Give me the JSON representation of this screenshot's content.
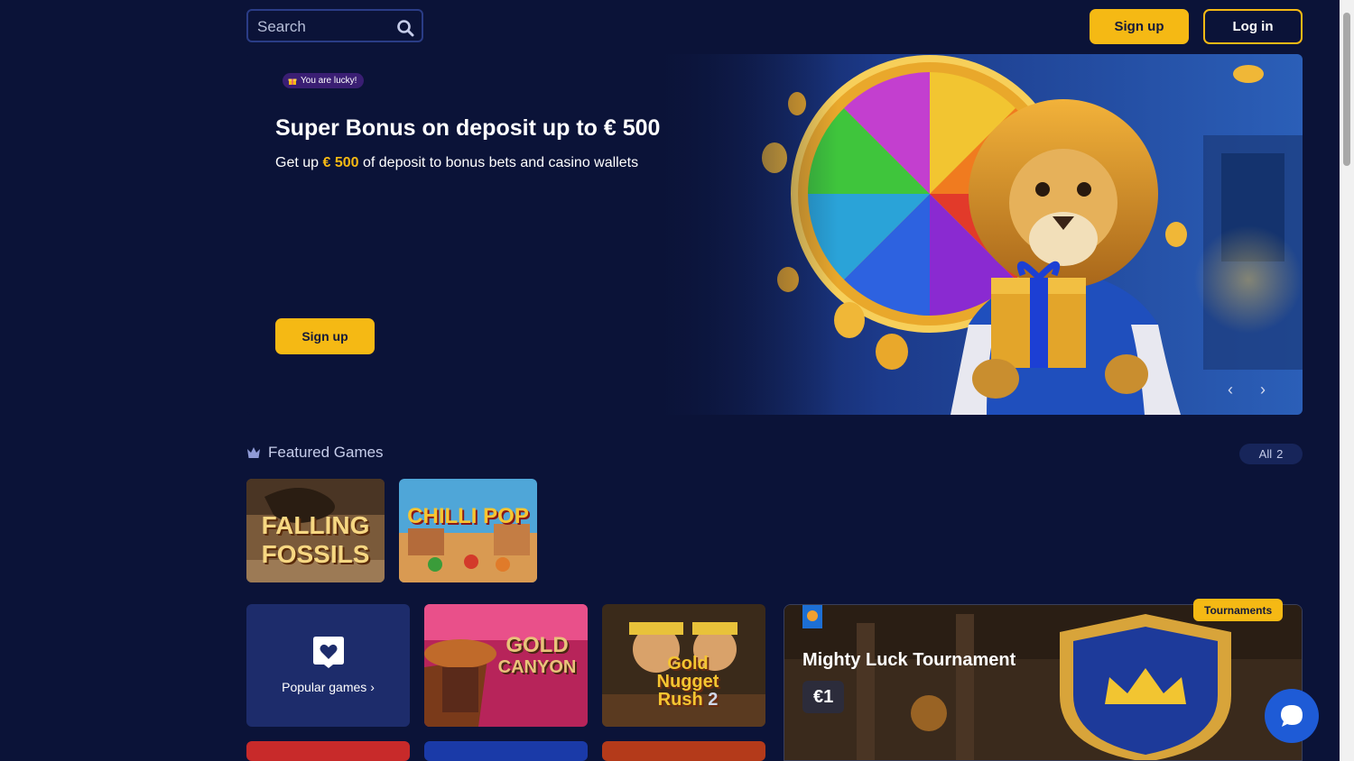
{
  "header": {
    "search_placeholder": "Search",
    "signup_label": "Sign up",
    "login_label": "Log in"
  },
  "hero": {
    "badge": "You are lucky!",
    "title": "Super Bonus on deposit up to € 500",
    "subtitle_prefix": "Get up ",
    "subtitle_amount": "€ 500",
    "subtitle_suffix": " of deposit to bonus bets and casino wallets",
    "cta_label": "Sign up",
    "prev_icon": "chevron-left-icon",
    "next_icon": "chevron-right-icon"
  },
  "featured": {
    "title": "Featured Games",
    "all_label": "All",
    "all_count": "2",
    "games": [
      {
        "title_line1": "FALLING",
        "title_line2": "FOSSILS"
      },
      {
        "title_line1": "CHILLI POP",
        "title_line2": ""
      }
    ]
  },
  "popular": {
    "label": "Popular games",
    "icon": "heart-icon"
  },
  "games_row": [
    {
      "title_line1": "GOLD",
      "title_line2": "CANYON"
    },
    {
      "title_line1": "Gold",
      "title_line2": "Nugget",
      "title_line3": "Rush",
      "title_num": "2"
    }
  ],
  "tournament": {
    "tag": "Tournaments",
    "title": "Mighty Luck Tournament",
    "prize": "€1"
  },
  "colors": {
    "background": "#0b1338",
    "accent": "#f5b914",
    "panel": "#1d2c6b",
    "chat": "#1e5bd6"
  }
}
